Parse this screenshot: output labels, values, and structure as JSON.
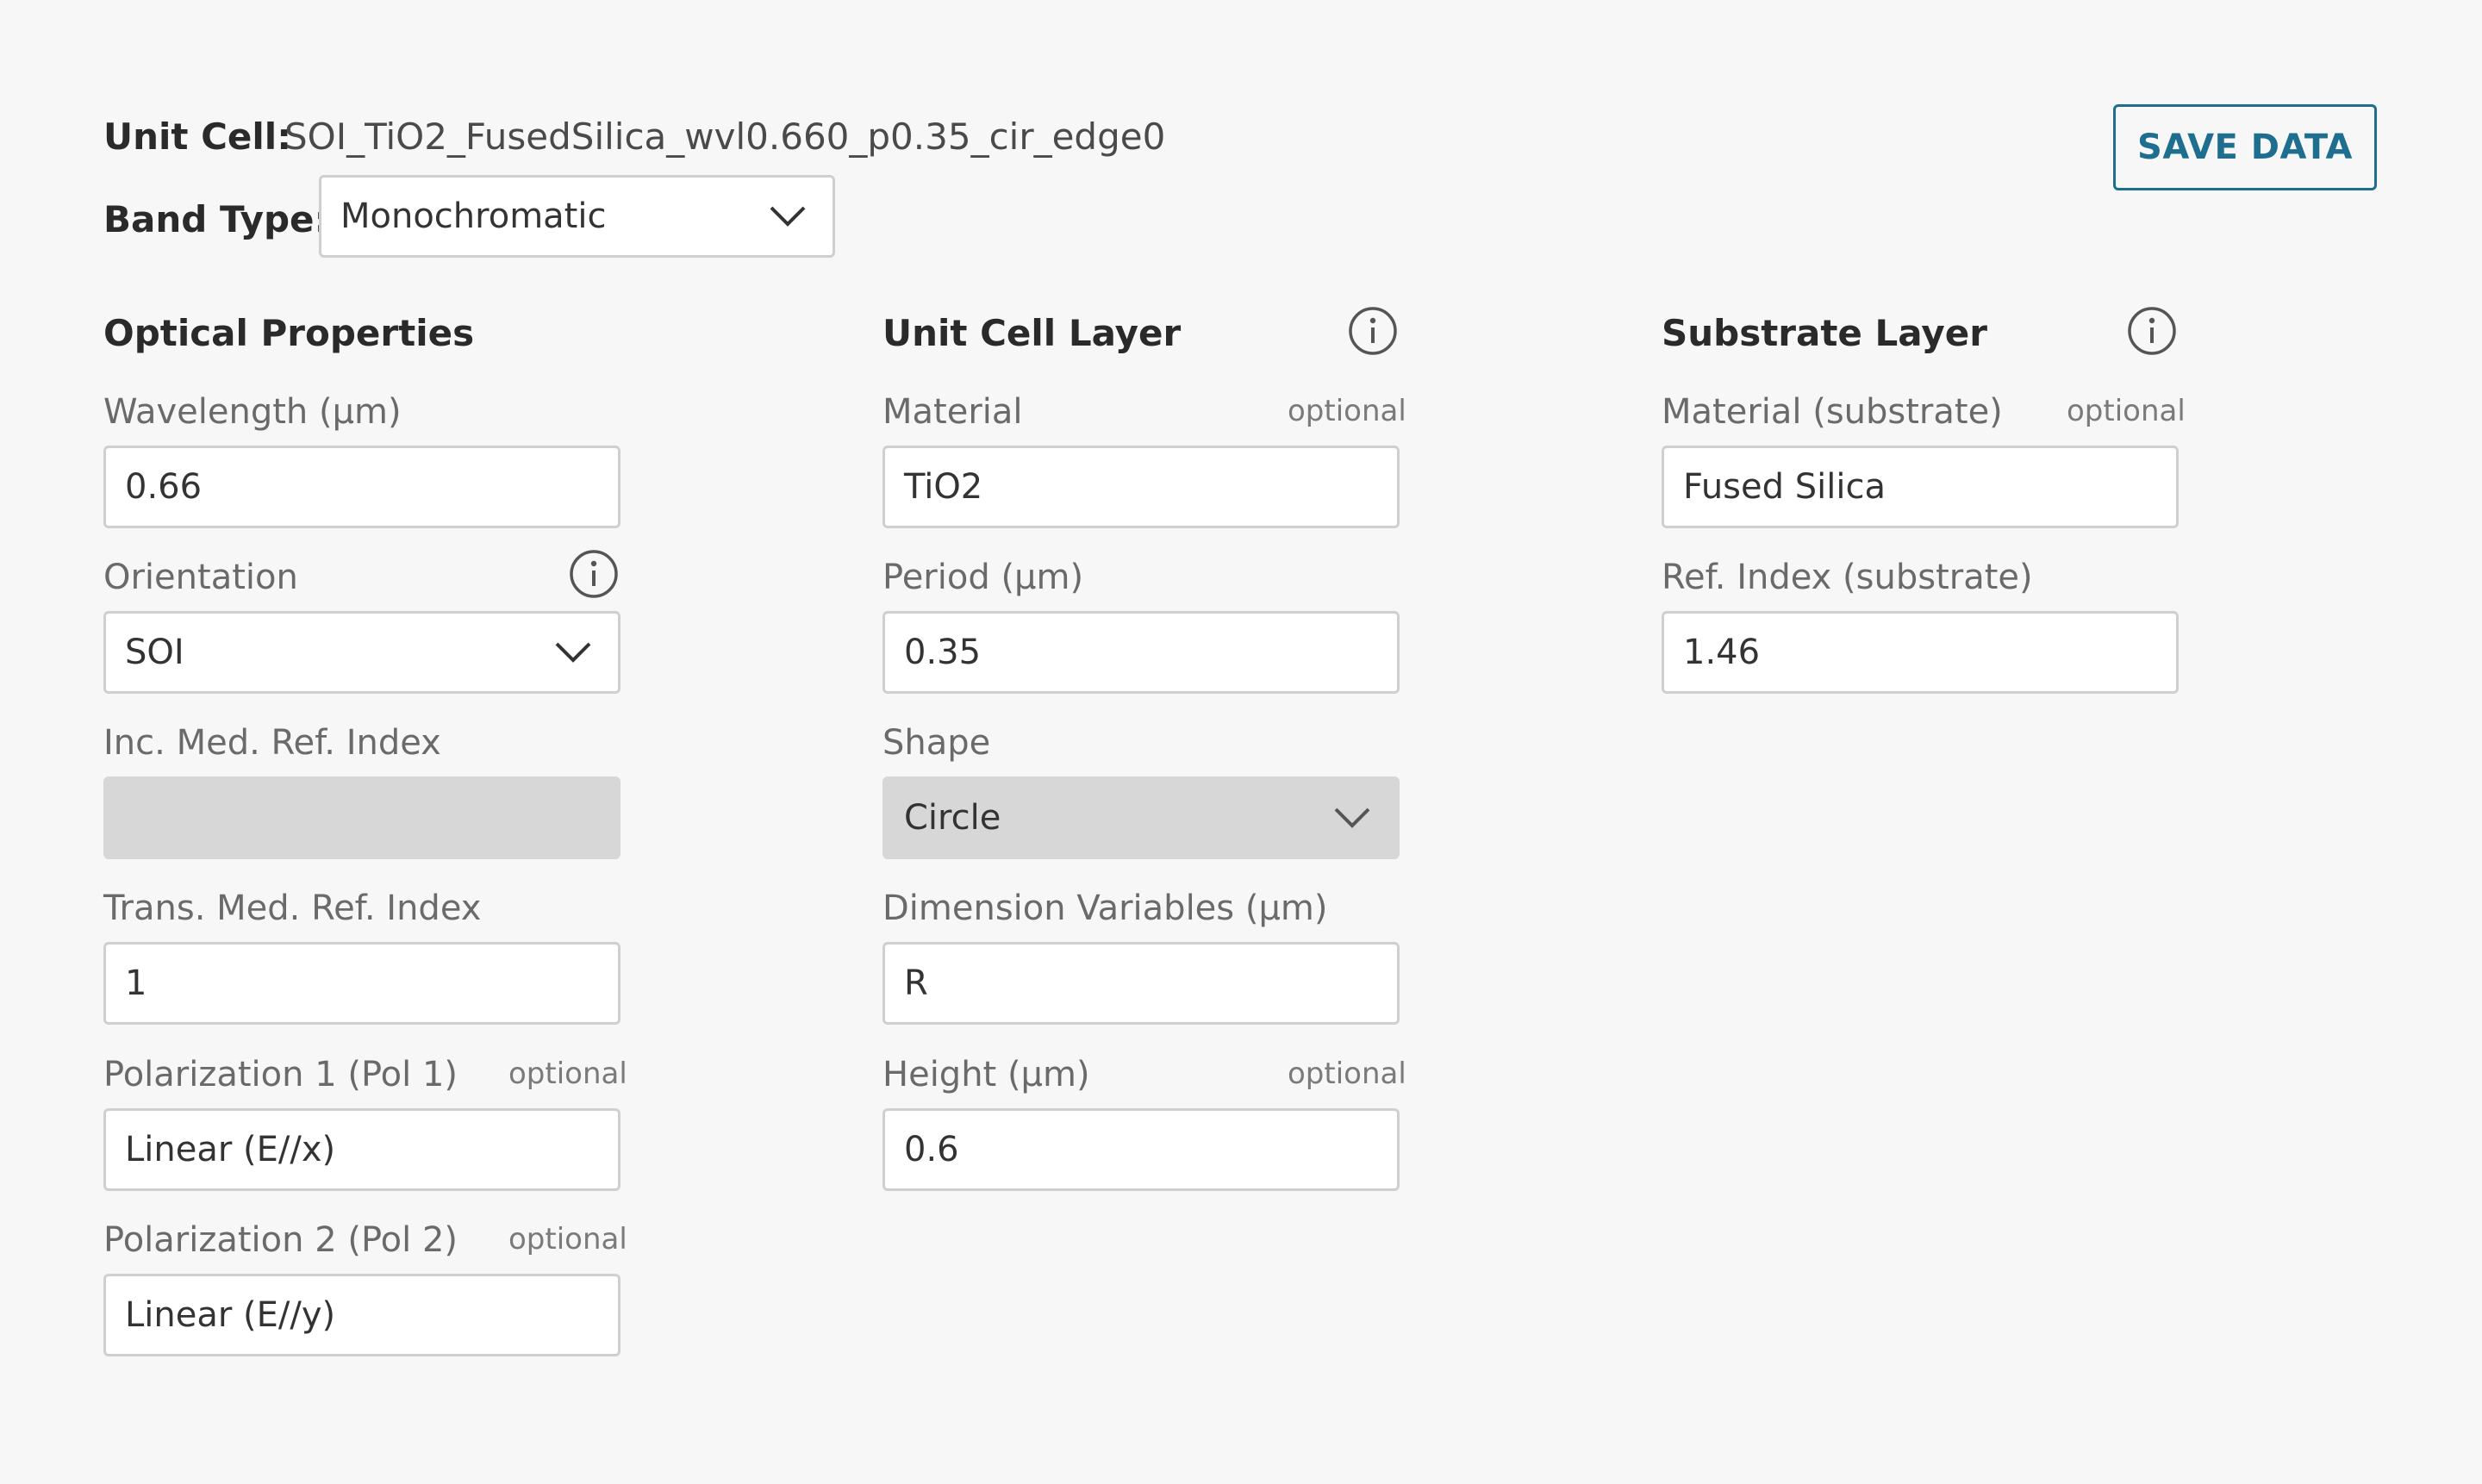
{
  "header": {
    "unit_cell_label": "Unit Cell:",
    "unit_cell_value": "SOI_TiO2_FusedSilica_wvl0.660_p0.35_cir_edge0",
    "band_type_label": "Band Type:",
    "band_type_value": "Monochromatic",
    "save_label": "SAVE DATA"
  },
  "optical": {
    "title": "Optical Properties",
    "wavelength_label": "Wavelength (μm)",
    "wavelength_value": "0.66",
    "orientation_label": "Orientation",
    "orientation_value": "SOI",
    "inc_label": "Inc. Med. Ref. Index",
    "inc_value": "",
    "trans_label": "Trans. Med. Ref. Index",
    "trans_value": "1",
    "pol1_label": "Polarization 1 (Pol 1)",
    "pol1_value": "Linear (E//x)",
    "pol2_label": "Polarization 2 (Pol 2)",
    "pol2_value": "Linear (E//y)"
  },
  "unit_cell_layer": {
    "title": "Unit Cell Layer",
    "material_label": "Material",
    "material_value": "TiO2",
    "period_label": "Period (μm)",
    "period_value": "0.35",
    "shape_label": "Shape",
    "shape_value": "Circle",
    "dim_label": "Dimension Variables (μm)",
    "dim_value": "R",
    "height_label": "Height (μm)",
    "height_value": "0.6"
  },
  "substrate": {
    "title": "Substrate Layer",
    "material_label": "Material (substrate)",
    "material_value": "Fused Silica",
    "ref_label": "Ref. Index (substrate)",
    "ref_value": "1.46"
  },
  "common": {
    "optional": "optional"
  },
  "icons": {
    "info": "info-icon",
    "chevron": "chevron-down-icon"
  }
}
